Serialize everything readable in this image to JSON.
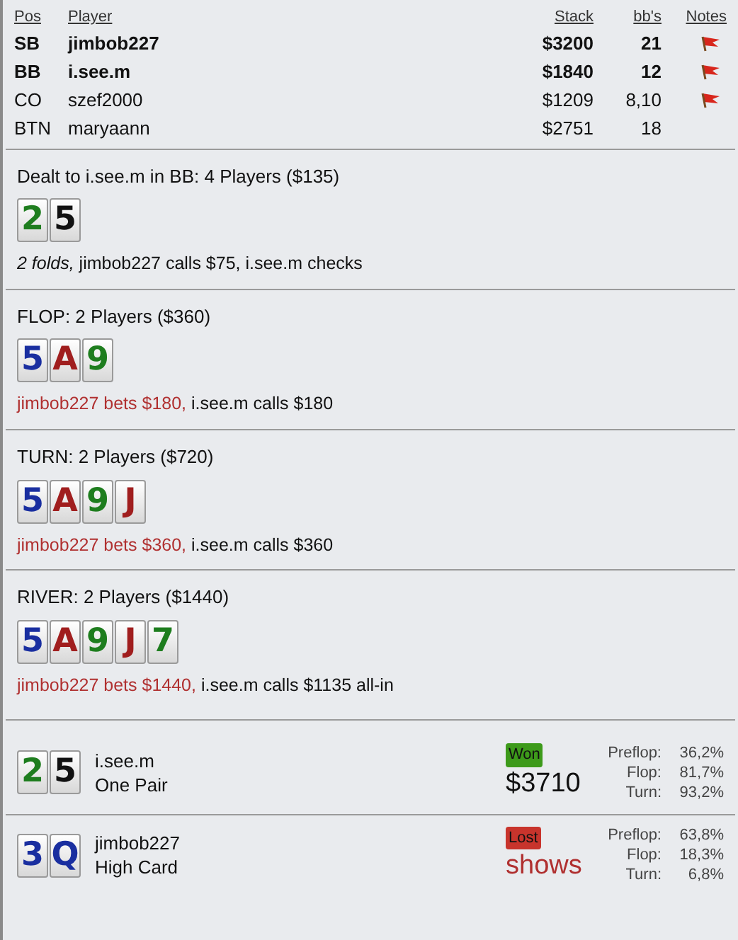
{
  "players_table": {
    "columns": [
      "Pos",
      "Player",
      "Stack",
      "bb's",
      "Notes"
    ],
    "rows": [
      {
        "pos": "SB",
        "player": "jimbob227",
        "stack": "$3200",
        "bbs": "21",
        "highlighted": true,
        "note": true
      },
      {
        "pos": "BB",
        "player": "i.see.m",
        "stack": "$1840",
        "bbs": "12",
        "highlighted": true,
        "note": true
      },
      {
        "pos": "CO",
        "player": "szef2000",
        "stack": "$1209",
        "bbs": "8,10",
        "highlighted": false,
        "note": true
      },
      {
        "pos": "BTN",
        "player": "maryaann",
        "stack": "$2751",
        "bbs": "18",
        "highlighted": false,
        "note": false
      }
    ]
  },
  "streets": [
    {
      "title": "Dealt to i.see.m in BB: 4 Players ($135)",
      "cards": [
        {
          "rank": "2",
          "color": "#1e7d1e"
        },
        {
          "rank": "5",
          "color": "#111111"
        }
      ],
      "actions": [
        {
          "kind": "fold",
          "text": "2 folds,"
        },
        {
          "kind": "plain",
          "text": "jimbob227 calls $75, i.see.m checks"
        }
      ]
    },
    {
      "title": "FLOP: 2 Players ($360)",
      "cards": [
        {
          "rank": "5",
          "color": "#1a2fa0"
        },
        {
          "rank": "A",
          "color": "#a01e1e"
        },
        {
          "rank": "9",
          "color": "#1e7d1e"
        }
      ],
      "actions": [
        {
          "kind": "bet",
          "text": "jimbob227 bets $180,"
        },
        {
          "kind": "plain",
          "text": "i.see.m calls $180"
        }
      ]
    },
    {
      "title": "TURN: 2 Players ($720)",
      "cards": [
        {
          "rank": "5",
          "color": "#1a2fa0"
        },
        {
          "rank": "A",
          "color": "#a01e1e"
        },
        {
          "rank": "9",
          "color": "#1e7d1e"
        },
        {
          "rank": "J",
          "color": "#a01e1e"
        }
      ],
      "actions": [
        {
          "kind": "bet",
          "text": "jimbob227 bets $360,"
        },
        {
          "kind": "plain",
          "text": "i.see.m calls $360"
        }
      ]
    },
    {
      "title": "RIVER: 2 Players ($1440)",
      "cards": [
        {
          "rank": "5",
          "color": "#1a2fa0"
        },
        {
          "rank": "A",
          "color": "#a01e1e"
        },
        {
          "rank": "9",
          "color": "#1e7d1e"
        },
        {
          "rank": "J",
          "color": "#a01e1e"
        },
        {
          "rank": "7",
          "color": "#1e7d1e"
        }
      ],
      "actions": [
        {
          "kind": "bet",
          "text": "jimbob227 bets $1440,"
        },
        {
          "kind": "plain",
          "text": "i.see.m calls $1135 all-in"
        }
      ]
    }
  ],
  "showdown": [
    {
      "cards": [
        {
          "rank": "2",
          "color": "#1e7d1e"
        },
        {
          "rank": "5",
          "color": "#111111"
        }
      ],
      "player": "i.see.m",
      "hand": "One Pair",
      "kind": "won",
      "result": "Won",
      "amount": "$3710",
      "equity": [
        {
          "label": "Preflop:",
          "value": "36,2%"
        },
        {
          "label": "Flop:",
          "value": "81,7%"
        },
        {
          "label": "Turn:",
          "value": "93,2%"
        }
      ]
    },
    {
      "cards": [
        {
          "rank": "3",
          "color": "#1a2fa0"
        },
        {
          "rank": "Q",
          "color": "#1a2fa0"
        }
      ],
      "player": "jimbob227",
      "hand": "High Card",
      "kind": "lost",
      "result": "Lost",
      "amount": "shows",
      "equity": [
        {
          "label": "Preflop:",
          "value": "63,8%"
        },
        {
          "label": "Flop:",
          "value": "18,3%"
        },
        {
          "label": "Turn:",
          "value": "6,8%"
        }
      ]
    }
  ]
}
